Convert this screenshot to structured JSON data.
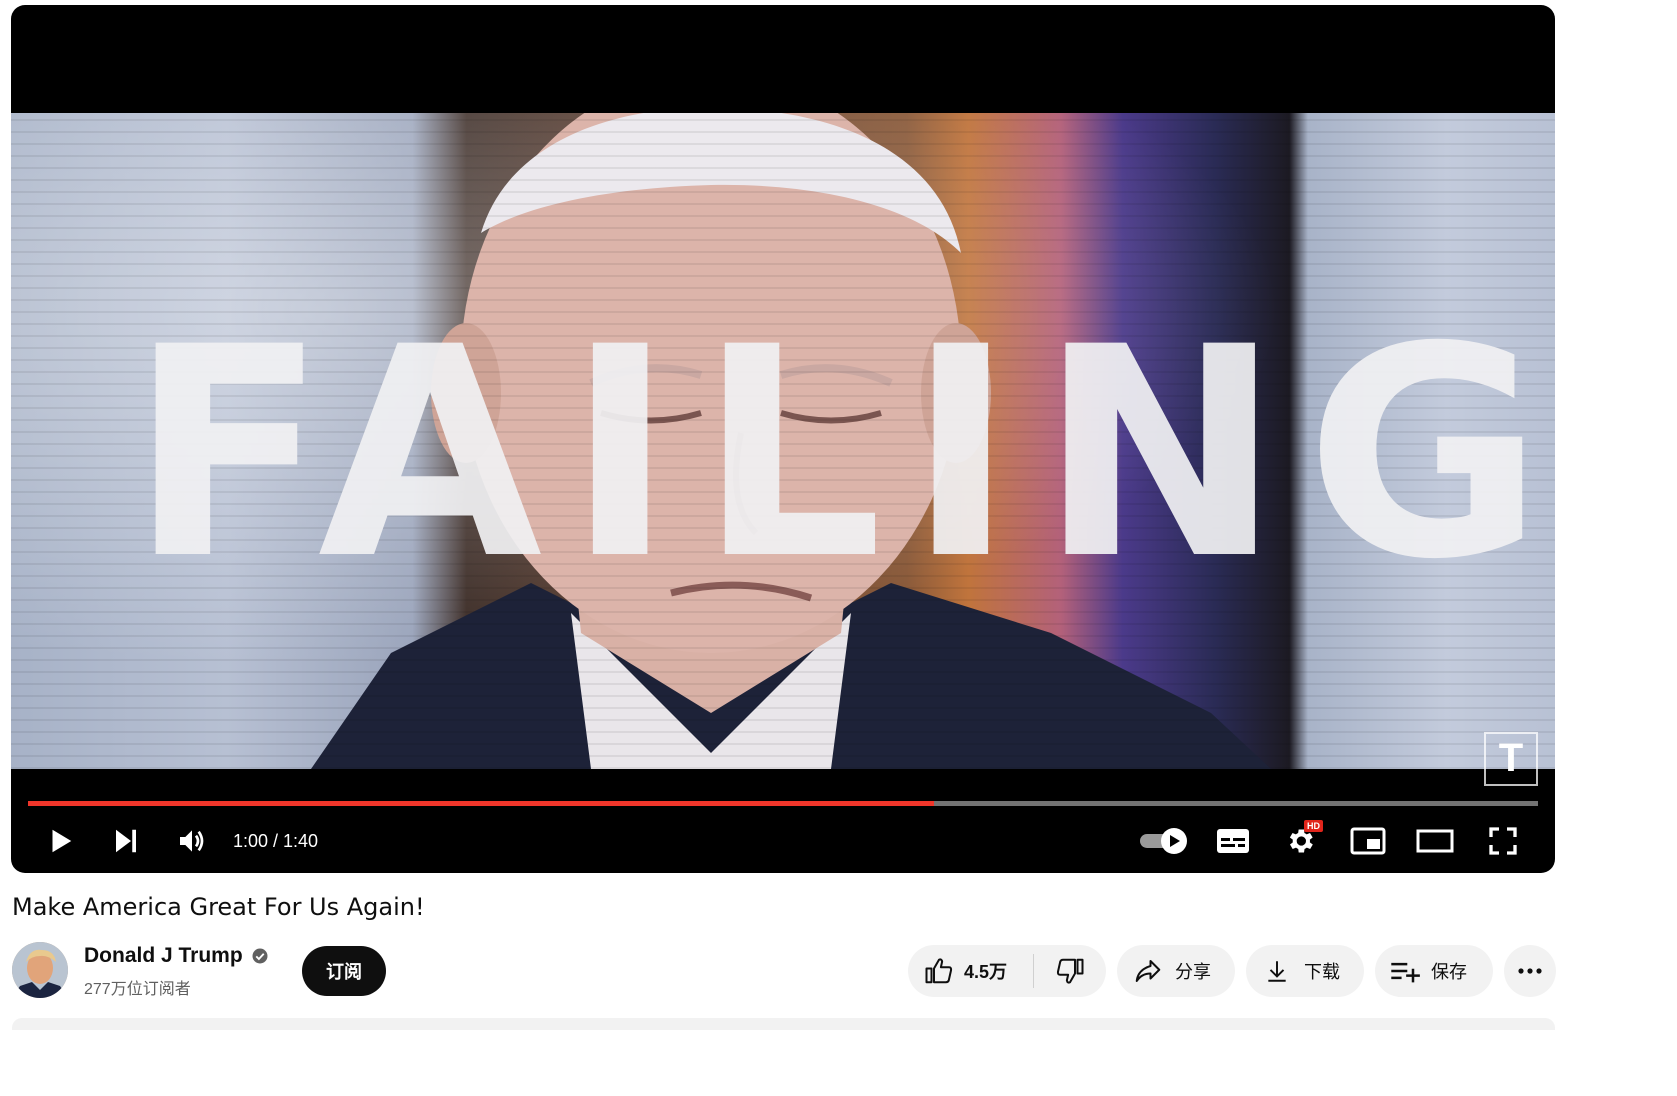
{
  "video": {
    "overlay_text": "FAILING",
    "watermark_letter": "T",
    "time_display": "1:00 / 1:40",
    "progress": 0.6,
    "hd_badge": "HD"
  },
  "info": {
    "title": "Make America Great For Us Again!",
    "channel_name": "Donald J Trump",
    "subscribers": "277万位订阅者",
    "subscribe_label": "订阅"
  },
  "actions": {
    "like_count": "4.5万",
    "share_label": "分享",
    "download_label": "下载",
    "save_label": "保存"
  },
  "colors": {
    "progress": "#f0352a",
    "subscribe_bg": "#0f0f0f",
    "pill_bg": "#f2f2f2"
  },
  "icons": [
    "play-icon",
    "next-icon",
    "volume-icon",
    "autoplay-toggle-icon",
    "subtitles-icon",
    "settings-icon",
    "miniplayer-icon",
    "theater-icon",
    "fullscreen-icon",
    "verified-icon",
    "thumbs-up-icon",
    "thumbs-down-icon",
    "share-icon",
    "download-icon",
    "save-playlist-icon",
    "more-icon"
  ]
}
